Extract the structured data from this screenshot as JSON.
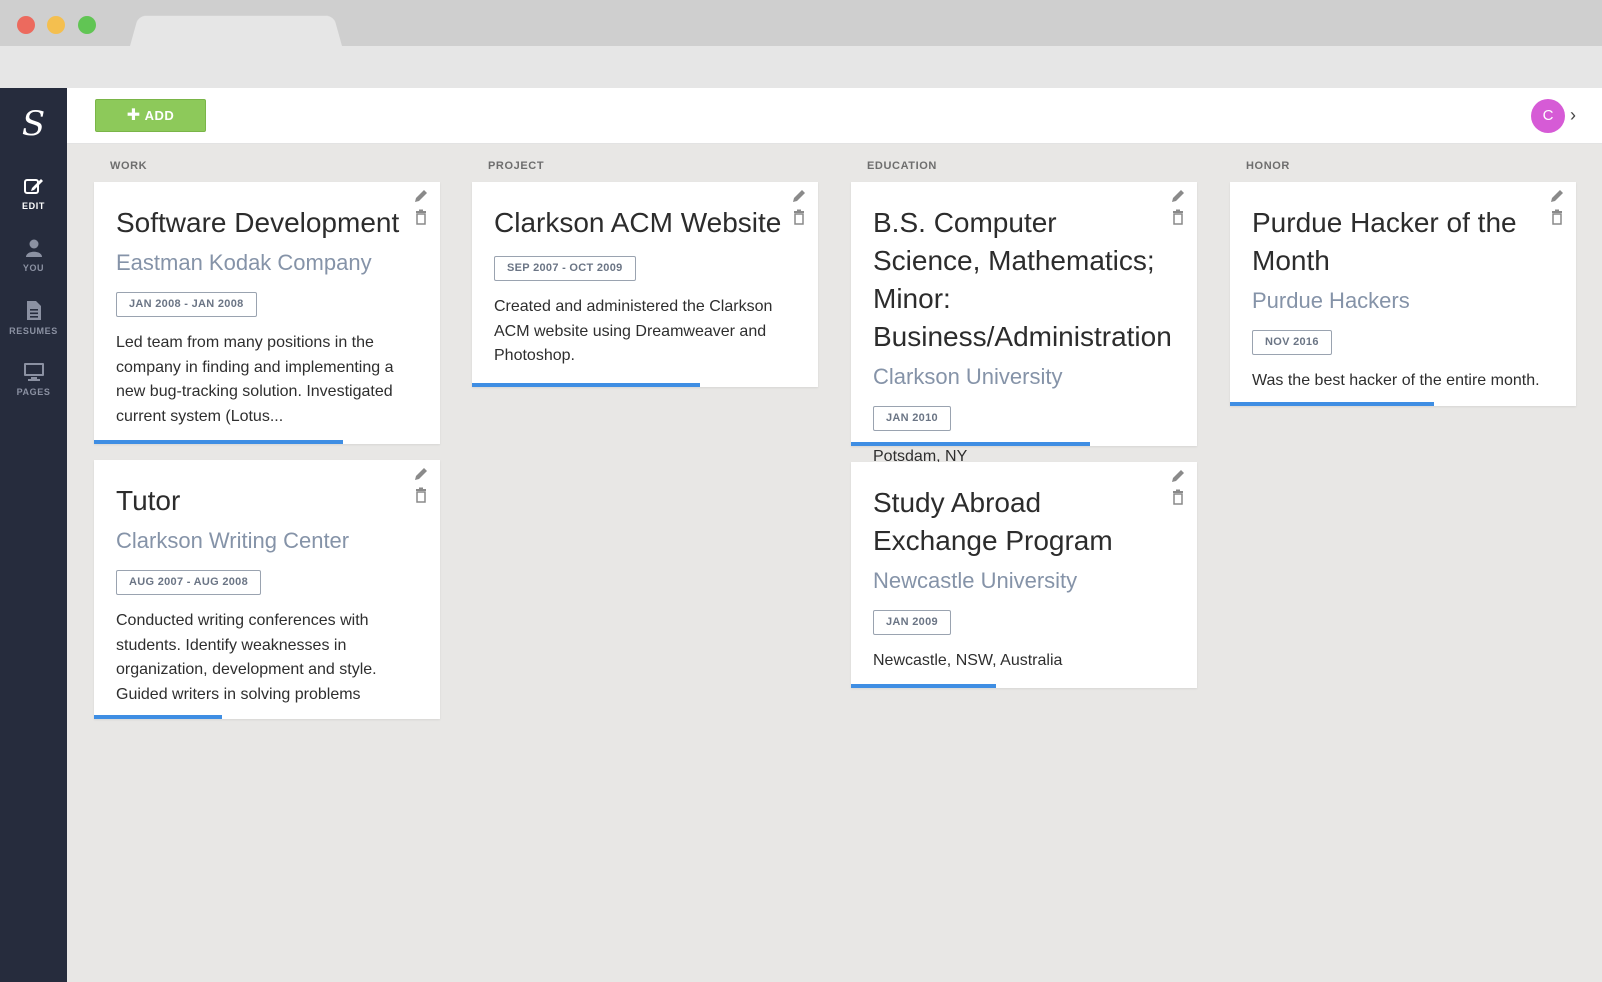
{
  "sidebar": {
    "logo": "S",
    "items": [
      {
        "label": "EDIT",
        "icon": "edit-icon"
      },
      {
        "label": "YOU",
        "icon": "user-icon"
      },
      {
        "label": "RESUMES",
        "icon": "document-icon"
      },
      {
        "label": "PAGES",
        "icon": "monitor-icon"
      }
    ]
  },
  "toolbar": {
    "add_label": "ADD",
    "add_icon": "plus-icon",
    "avatar_initial": "C"
  },
  "columns": [
    {
      "title": "WORK",
      "cards": [
        {
          "title": "Software Development",
          "org": "Eastman Kodak Company",
          "date": "JAN 2008 - JAN 2008",
          "description": "Led team from many positions in the company in finding and implementing a new bug-tracking solution. Investigated current system (Lotus...",
          "progress": 0.72
        },
        {
          "title": "Tutor",
          "org": "Clarkson Writing Center",
          "date": "AUG 2007 - AUG 2008",
          "description": "Conducted writing conferences with students. Identify weaknesses in organization, development and style. Guided writers in solving problems",
          "progress": 0.37
        }
      ]
    },
    {
      "title": "PROJECT",
      "cards": [
        {
          "title": "Clarkson ACM Website",
          "org": "",
          "date": "SEP 2007 - OCT 2009",
          "description": "Created and administered the Clarkson ACM website using Dreamweaver and Photoshop.",
          "progress": 0.66
        }
      ]
    },
    {
      "title": "EDUCATION",
      "cards": [
        {
          "title": "B.S. Computer Science, Mathematics; Minor: Business/Administration",
          "org": "Clarkson University",
          "date": "JAN 2010",
          "description": "Potsdam, NY",
          "progress": 0.69
        },
        {
          "title": "Study Abroad Exchange Program",
          "org": "Newcastle University",
          "date": "JAN 2009",
          "description": "Newcastle, NSW, Australia",
          "progress": 0.42
        }
      ]
    },
    {
      "title": "HONOR",
      "cards": [
        {
          "title": "Purdue Hacker of the Month",
          "org": "Purdue Hackers",
          "date": "NOV 2016",
          "description": "Was the best hacker of the entire month.",
          "progress": 0.59
        }
      ]
    }
  ],
  "colors": {
    "sidebar": "#262c3d",
    "add_button": "#8dc95a",
    "avatar": "#d65bd6",
    "progress": "#3f8ee3",
    "org_text": "#8593a8",
    "board_background": "#e8e7e5"
  }
}
